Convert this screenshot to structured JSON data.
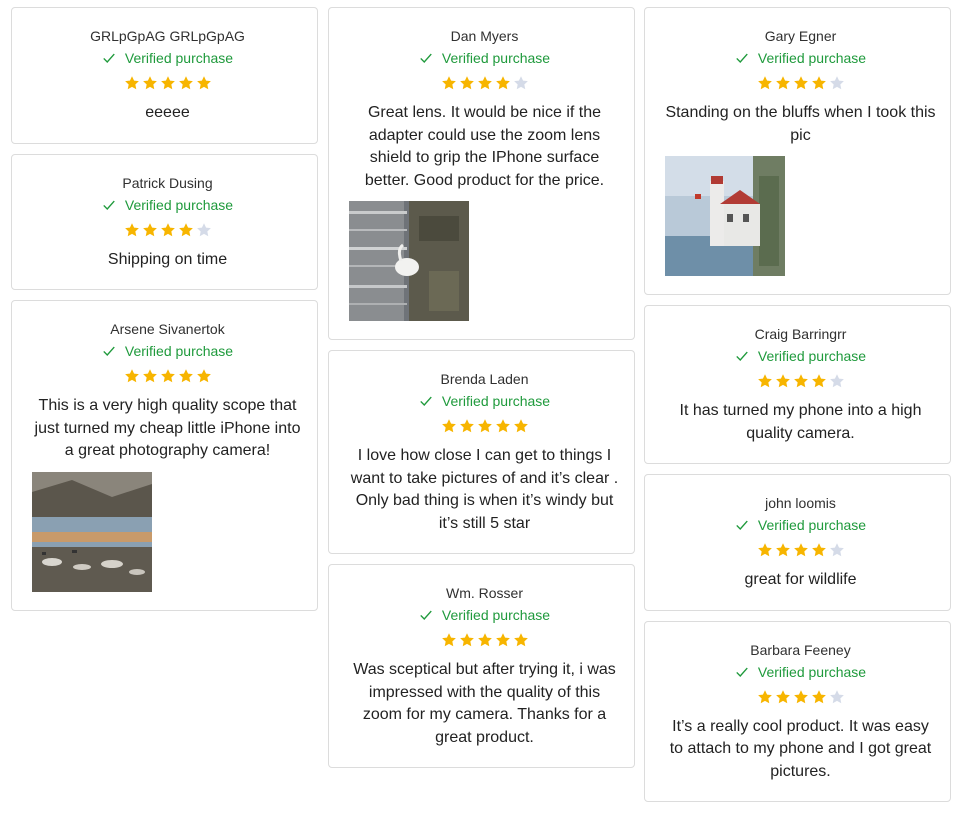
{
  "colors": {
    "star_filled": "#f7b500",
    "star_empty": "#d5dbe8",
    "verified": "#1f9a3c",
    "border": "#dcdcdc"
  },
  "verified_label": "Verified purchase",
  "columns": [
    [
      {
        "name": "GRLpGpAG GRLpGpAG",
        "rating": 5,
        "text": "eeeee",
        "image": null
      },
      {
        "name": "Patrick Dusing",
        "rating": 4,
        "text": "Shipping on time",
        "image": null
      },
      {
        "name": "Arsene Sivanertok",
        "rating": 5,
        "text": "This is a very high quality scope that just turned my cheap little iPhone into a great photography camera!",
        "image": "lake-landscape"
      }
    ],
    [
      {
        "name": "Dan Myers",
        "rating": 4,
        "text": "Great lens. It would be nice if the adapter could use the zoom lens shield to grip the IPhone surface better. Good product for the price.",
        "image": "egret-in-water"
      },
      {
        "name": "Brenda Laden",
        "rating": 5,
        "text": "I love how close I can get to things I want to take pictures of and it’s clear . Only bad thing is when it’s windy but it’s still 5 star",
        "image": null
      },
      {
        "name": "Wm. Rosser",
        "rating": 5,
        "text": "Was sceptical but after trying it, i was impressed with the quality of this zoom for my camera. Thanks for a great product.",
        "image": null
      }
    ],
    [
      {
        "name": "Gary Egner",
        "rating": 4,
        "text": "Standing on the bluffs when I took this pic",
        "image": "lighthouse"
      },
      {
        "name": "Craig Barringrr",
        "rating": 4,
        "text": "It has turned my phone into a high quality camera.",
        "image": null
      },
      {
        "name": "john loomis",
        "rating": 4,
        "text": "great for wildlife",
        "image": null
      },
      {
        "name": "Barbara Feeney",
        "rating": 4,
        "text": "It’s a really cool product. It was easy to attach to my phone and I got great pictures.",
        "image": null
      }
    ]
  ]
}
